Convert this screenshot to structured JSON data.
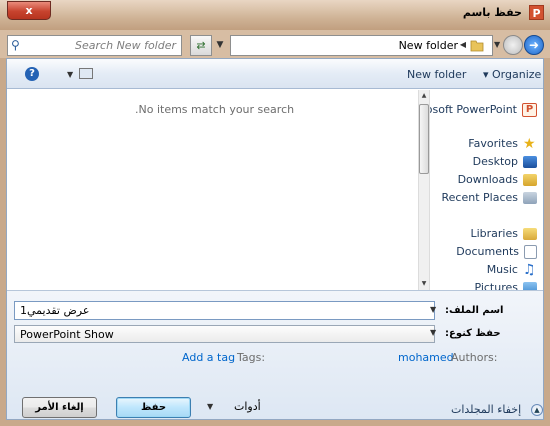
{
  "window": {
    "title": "حفظ باسم",
    "close_label": "x",
    "app_icon": "P"
  },
  "address": {
    "search_placeholder": "Search New folder",
    "path": "New folder",
    "icons": {
      "search": "search-icon",
      "refresh": "refresh-icon",
      "folder": "folder-icon",
      "back": "back-arrow-icon",
      "forward": "forward-arrow-icon"
    }
  },
  "toolbar": {
    "help_icon": "?",
    "new_folder": "New folder",
    "organize": "▾ Organize"
  },
  "content": {
    "empty_message": ".No items match your search"
  },
  "nav": {
    "items": [
      {
        "label": "crosoft PowerPoint",
        "icon": "powerpoint-icon"
      },
      {
        "label": "Favorites",
        "icon": "star-icon"
      },
      {
        "label": "Desktop",
        "icon": "desktop-icon"
      },
      {
        "label": "Downloads",
        "icon": "downloads-icon"
      },
      {
        "label": "Recent Places",
        "icon": "recent-places-icon"
      },
      {
        "label": "Libraries",
        "icon": "libraries-icon"
      },
      {
        "label": "Documents",
        "icon": "documents-icon"
      },
      {
        "label": "Music",
        "icon": "music-icon"
      },
      {
        "label": "Pictures",
        "icon": "pictures-icon"
      }
    ],
    "selected": "Desktop"
  },
  "form": {
    "filename_label": "اسم الملف:",
    "filename_value": "عرض تقديمي1",
    "savetype_label": "حفظ كنوع:",
    "savetype_value": "PowerPoint Show",
    "tags_label": ":Tags",
    "tags_link": "Add a tag",
    "authors_label": ":Authors",
    "authors_value": "mohamed"
  },
  "footer": {
    "hide_folders": "إخفاء المجلدات",
    "tools": "أدوات",
    "save": "حفظ",
    "cancel": "إلغاء الأمر"
  }
}
